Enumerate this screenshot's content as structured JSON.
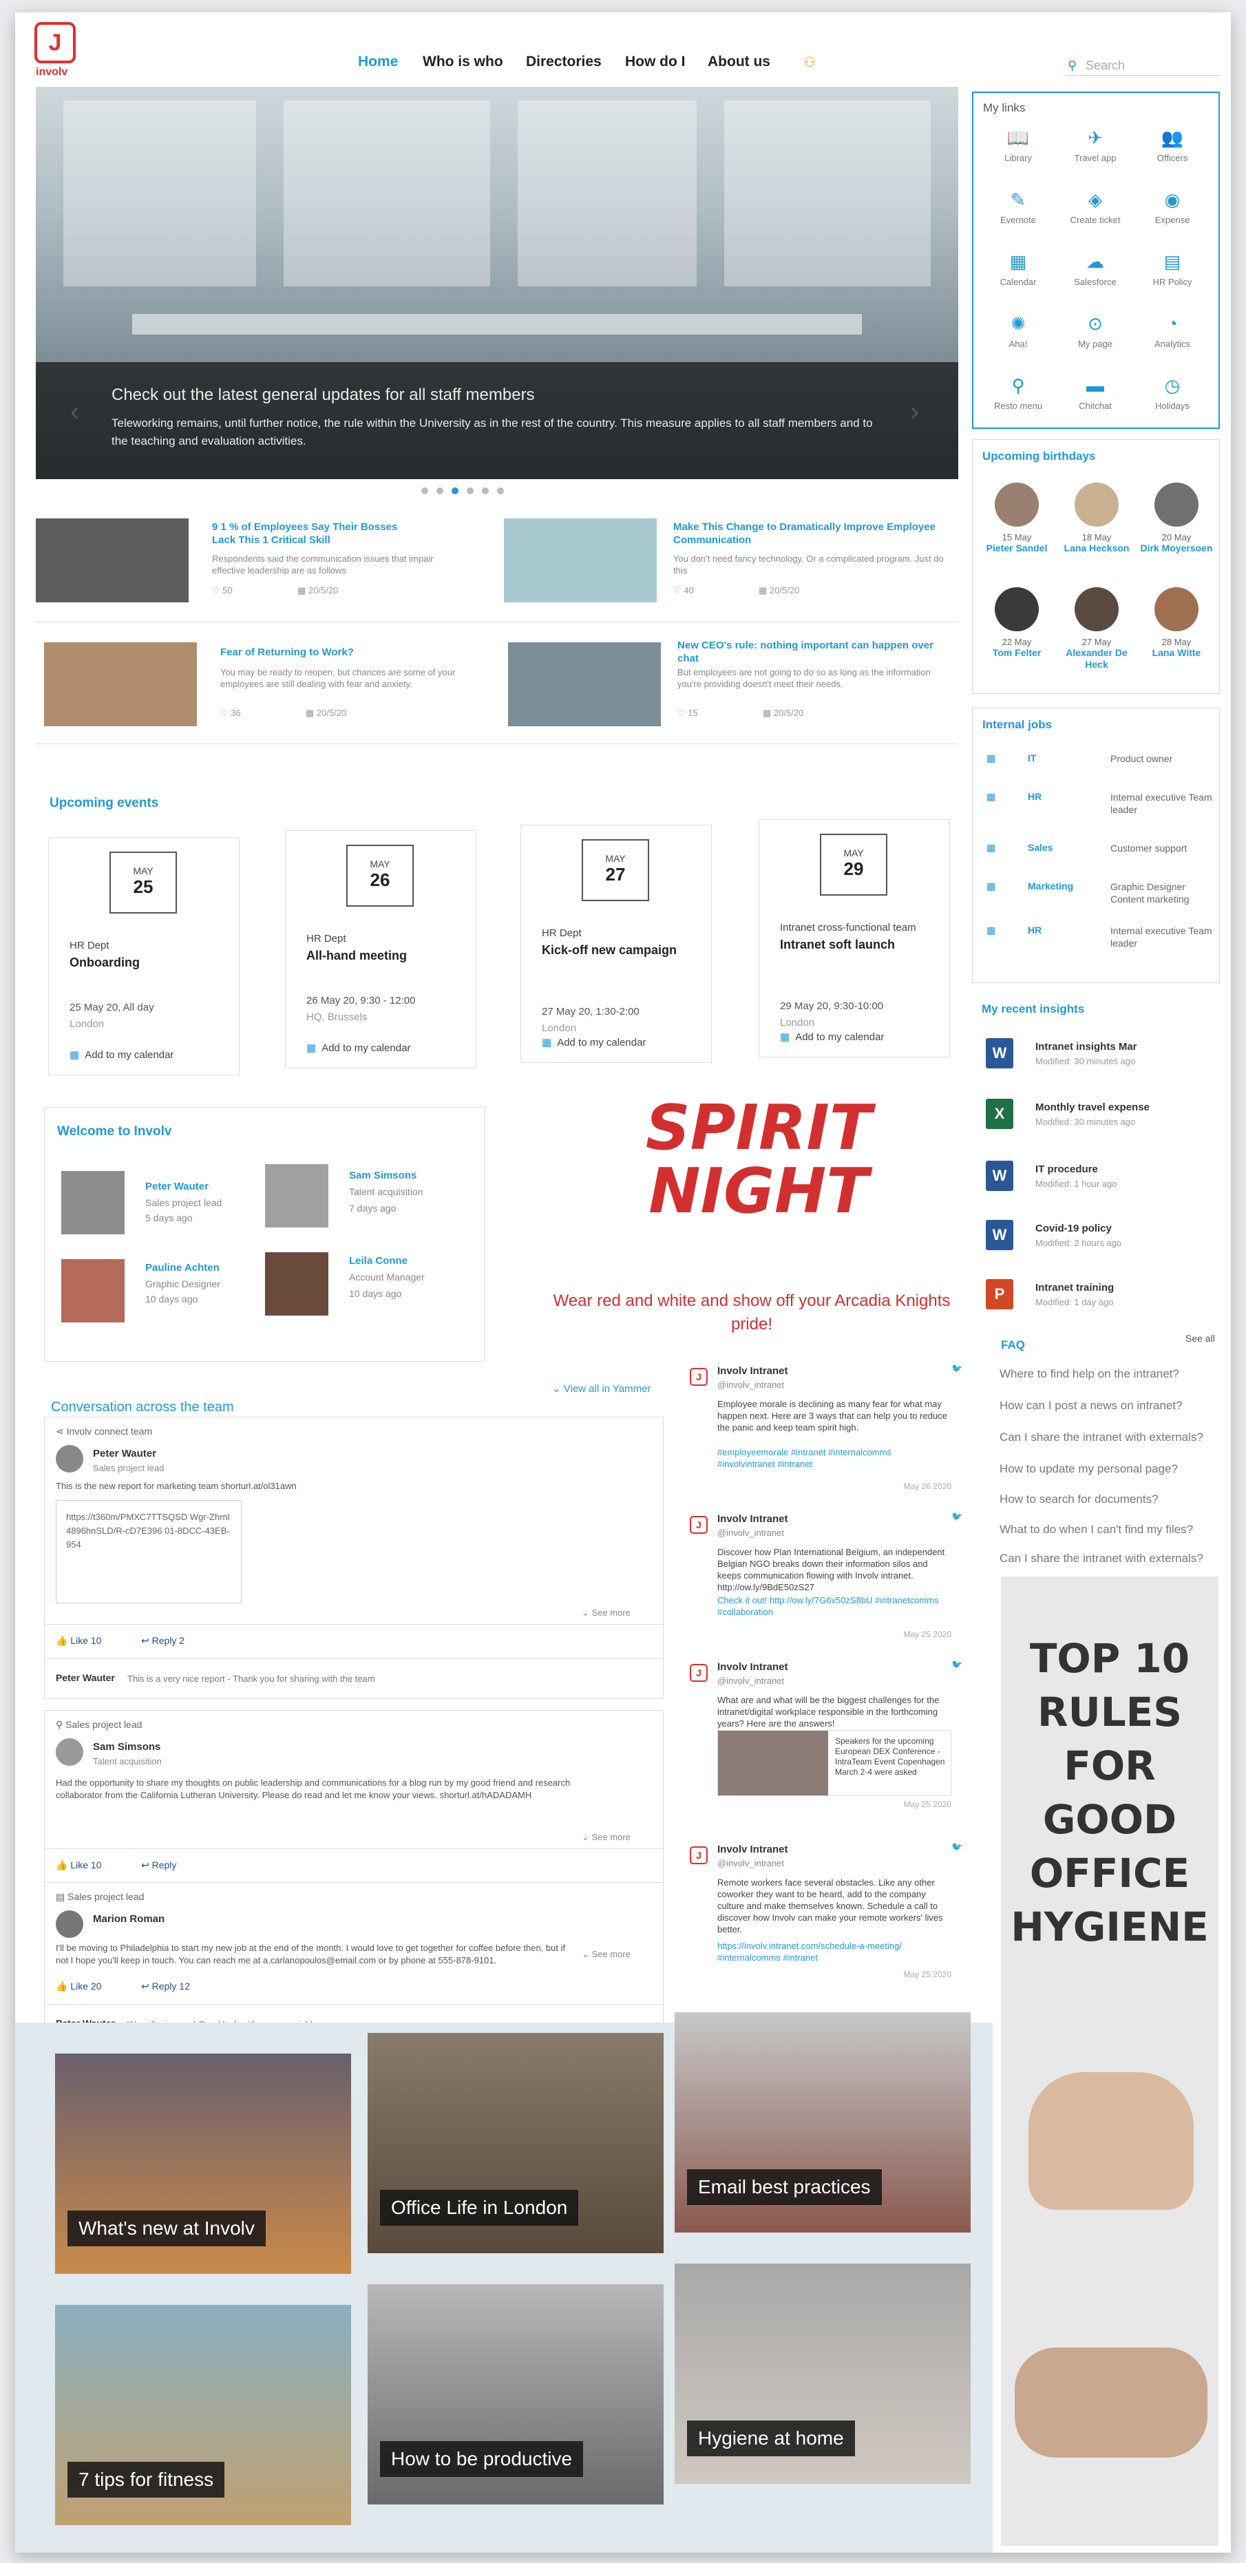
{
  "header": {
    "logo_letter": "J",
    "logo_text": "involv",
    "nav": [
      "Home",
      "Who is who",
      "Directories",
      "How do I",
      "About us"
    ],
    "search_placeholder": "Search"
  },
  "hero": {
    "title": "Check out the latest general updates for all staff members",
    "text": "Teleworking remains, until further notice, the rule within the University as in the rest of the country. This measure applies to all staff members and to the teaching and evaluation activities."
  },
  "news": [
    {
      "title": "9 1 % of Employees Say Their Bosses Lack This 1 Critical Skill",
      "text": "Respondents said the communication issues that impair effective leadership are as follows",
      "likes": "50",
      "date": "20/5/20"
    },
    {
      "title": "Make This Change to Dramatically Improve Employee Communication",
      "text": "You don't need fancy technology. Or a complicated program. Just do this",
      "likes": "40",
      "date": "20/5/20"
    },
    {
      "title": "Fear of Returning to Work?",
      "text": "You may be ready to reopen, but chances are some of your employees are still dealing with fear and anxiety.",
      "likes": "36",
      "date": "20/5/20"
    },
    {
      "title": "New CEO's rule: nothing important can happen over chat",
      "text": "But employees are not going to do so as long as the information you're providing doesn't meet their needs.",
      "likes": "15",
      "date": "20/5/20"
    }
  ],
  "events": {
    "title": "Upcoming events",
    "add_label": "Add to my calendar",
    "items": [
      {
        "month": "MAY",
        "day": "25",
        "dept": "HR Dept",
        "name": "Onboarding",
        "date": "25 May 20, All day",
        "location": "London"
      },
      {
        "month": "MAY",
        "day": "26",
        "dept": "HR Dept",
        "name": "All-hand meeting",
        "date": "26 May 20, 9:30 - 12:00",
        "location": "HQ, Brussels"
      },
      {
        "month": "MAY",
        "day": "27",
        "dept": "HR Dept",
        "name": "Kick-off new campaign",
        "date": "27 May 20, 1:30-2:00",
        "location": "London"
      },
      {
        "month": "MAY",
        "day": "29",
        "dept": "Intranet cross-functional team",
        "name": "Intranet soft launch",
        "date": "29 May 20, 9:30-10:00",
        "location": "London"
      }
    ]
  },
  "welcome": {
    "title": "Welcome to Involv",
    "people": [
      {
        "name": "Peter Wauter",
        "role": "Sales project lead",
        "ago": "5 days ago"
      },
      {
        "name": "Sam Simsons",
        "role": "Talent acquisition",
        "ago": "7 days ago"
      },
      {
        "name": "Pauline Achten",
        "role": "Graphic Designer",
        "ago": "10 days ago"
      },
      {
        "name": "Leila Conne",
        "role": "Account Manager",
        "ago": "10 days ago"
      }
    ]
  },
  "spirit": {
    "line1": "SPIRIT",
    "line2": "NIGHT",
    "sub": "Wear red and white and show off your Arcadia Knights pride!"
  },
  "conversation": {
    "title": "Conversation across the team",
    "view_all": "View all in Yammer",
    "posts": [
      {
        "group": "Involv connect team",
        "author": "Peter Wauter",
        "role": "Sales project lead",
        "text": "This is the new report for marketing team shorturl.at/ol31awn",
        "attachment": "https://t360m/PMXC7TTSQSD Wgr-Zhrnl4896hnSLD/R-cD7E396 01-8DCC-43EB-954",
        "see_more": "See more",
        "likes": "Like  10",
        "reply": "Reply  2",
        "comment_author": "Peter Wauter",
        "comment": "This is a very nice report - Thank you for sharing with the team"
      },
      {
        "group": "Sales project lead",
        "author": "Sam Simsons",
        "role": "Talent acquisition",
        "text": "Had the opportunity to share my thoughts on public leadership and communications for a blog run by my good friend and research collaborator from the California Lutheran University. Please do read and let me know your views. shorturl.at/hADADAMH",
        "see_more": "See more",
        "likes": "Like  10",
        "reply": "Reply"
      },
      {
        "group": "Sales project lead",
        "author": "Marion Roman",
        "role": "",
        "text": "I'll be moving to Philadelphia to start my new job at the end of the month. I would love to get together for coffee before then, but if not I hope you'll keep in touch. You can reach me at a.carlanopoulos@email.com or by phone at 555-878-9101.",
        "see_more": "See more",
        "likes": "Like  20",
        "reply": "Reply  12",
        "comment_author": "Peter Wauter",
        "comment": "We will miss you! Good luck with your new job!"
      }
    ]
  },
  "tweets": [
    {
      "name": "Involv Intranet",
      "handle": "@involv_intranet",
      "text": "Employee morale is declining as many fear for what may happen next. Here are 3 ways that can help you to reduce the panic and keep team spirit high.",
      "tags": "#employeemorale #intranet #internalcomms #involvintranet #intranet",
      "date": "May 26 2020"
    },
    {
      "name": "Involv Intranet",
      "handle": "@involv_intranet",
      "text": "Discover how Plan International Belgium, an independent Belgian NGO breaks down their information silos and keeps communication flowing with Involv intranet. http://ow.ly/9BdE50zS27",
      "tags": "Check it out! http://ow.ly/7G6v50zS8bU #intranetcomms #collaboration",
      "date": "May 25 2020"
    },
    {
      "name": "Involv Intranet",
      "handle": "@involv_intranet",
      "text": "What are and what will be the biggest challenges for the intranet/digital workplace responsible in the forthcoming years? Here are the answers!",
      "card": "Speakers for the upcoming European DEX Conference - IntraTeam Event Copenhagen March 2-4 were asked",
      "date": "May 25 2020"
    },
    {
      "name": "Involv Intranet",
      "handle": "@involv_intranet",
      "text": "Remote workers face several obstacles. Like any other coworker they want to be heard, add to the company culture and make themselves known. Schedule a call to discover how Involv can make your remote workers' lives better.",
      "tags": "https://involv.intranet.com/schedule-a-meeting/ #internalcomms #intranet",
      "date": "May 25 2020"
    }
  ],
  "tiles": [
    "What's new at Involv",
    "Office Life in London",
    "Email best practices",
    "7 tips for fitness",
    "How to be productive",
    "Hygiene at home"
  ],
  "my_links": {
    "title": "My links",
    "items": [
      {
        "label": "Library",
        "icon": "library-icon",
        "glyph": "📖"
      },
      {
        "label": "Travel app",
        "icon": "plane-icon",
        "glyph": "✈"
      },
      {
        "label": "Officers",
        "icon": "people-icon",
        "glyph": "👥"
      },
      {
        "label": "Evernote",
        "icon": "evernote-icon",
        "glyph": "✎"
      },
      {
        "label": "Create ticket",
        "icon": "ticket-icon",
        "glyph": "◈"
      },
      {
        "label": "Expense",
        "icon": "piggy-bank-icon",
        "glyph": "◉"
      },
      {
        "label": "Calendar",
        "icon": "calendar-icon",
        "glyph": "▦"
      },
      {
        "label": "Salesforce",
        "icon": "cloud-icon",
        "glyph": "☁"
      },
      {
        "label": "HR Policy",
        "icon": "document-icon",
        "glyph": "▤"
      },
      {
        "label": "Aha!",
        "icon": "lightbulb-icon",
        "glyph": "✺"
      },
      {
        "label": "My page",
        "icon": "dots-icon",
        "glyph": "⊙"
      },
      {
        "label": "Analytics",
        "icon": "pie-chart-icon",
        "glyph": "◔"
      },
      {
        "label": "Resto menu",
        "icon": "fork-icon",
        "glyph": "⚲"
      },
      {
        "label": "Chitchat",
        "icon": "chat-icon",
        "glyph": "▬"
      },
      {
        "label": "Holidays",
        "icon": "clock-icon",
        "glyph": "◷"
      }
    ]
  },
  "birthdays": {
    "title": "Upcoming birthdays",
    "items": [
      {
        "date": "15 May",
        "name": "Pieter Sandel"
      },
      {
        "date": "18 May",
        "name": "Lana Heckson"
      },
      {
        "date": "20 May",
        "name": "Dirk Moyersoen"
      },
      {
        "date": "22 May",
        "name": "Tom Felter"
      },
      {
        "date": "27 May",
        "name": "Alexander De Heck"
      },
      {
        "date": "28 May",
        "name": "Lana Witte"
      }
    ]
  },
  "jobs": {
    "title": "Internal jobs",
    "items": [
      {
        "dept": "IT",
        "title": "Product owner"
      },
      {
        "dept": "HR",
        "title": "Internal executive Team leader"
      },
      {
        "dept": "Sales",
        "title": "Customer support"
      },
      {
        "dept": "Marketing",
        "title": "Graphic Designer Content marketing"
      },
      {
        "dept": "HR",
        "title": "Internal executive Team leader"
      }
    ]
  },
  "insights": {
    "title": "My recent insights",
    "items": [
      {
        "type": "W",
        "name": "Intranet insights Mar",
        "modified": "Modified: 30 minutes ago"
      },
      {
        "type": "X",
        "name": "Monthly travel expense",
        "modified": "Modified: 30 minutes ago"
      },
      {
        "type": "W",
        "name": "IT procedure",
        "modified": "Modified: 1 hour ago"
      },
      {
        "type": "W",
        "name": "Covid-19 policy",
        "modified": "Modified: 2 hours ago"
      },
      {
        "type": "P",
        "name": "Intranet training",
        "modified": "Modified: 1 day ago"
      }
    ]
  },
  "faq": {
    "title": "FAQ",
    "see_all": "See all",
    "items": [
      "Where to find help on the intranet?",
      "How can I post a news on intranet?",
      "Can I share the intranet with externals?",
      "How to update my personal page?",
      "How to search for documents?",
      "What to do when I can't find my files?",
      "Can I share the intranet with externals?"
    ]
  },
  "poster": {
    "title": "TOP 10 RULES FOR GOOD OFFICE HYGIENE"
  },
  "colors": {
    "accent": "#1f9ad6",
    "brand": "#e52d2d",
    "spirit": "#d32f2f"
  }
}
